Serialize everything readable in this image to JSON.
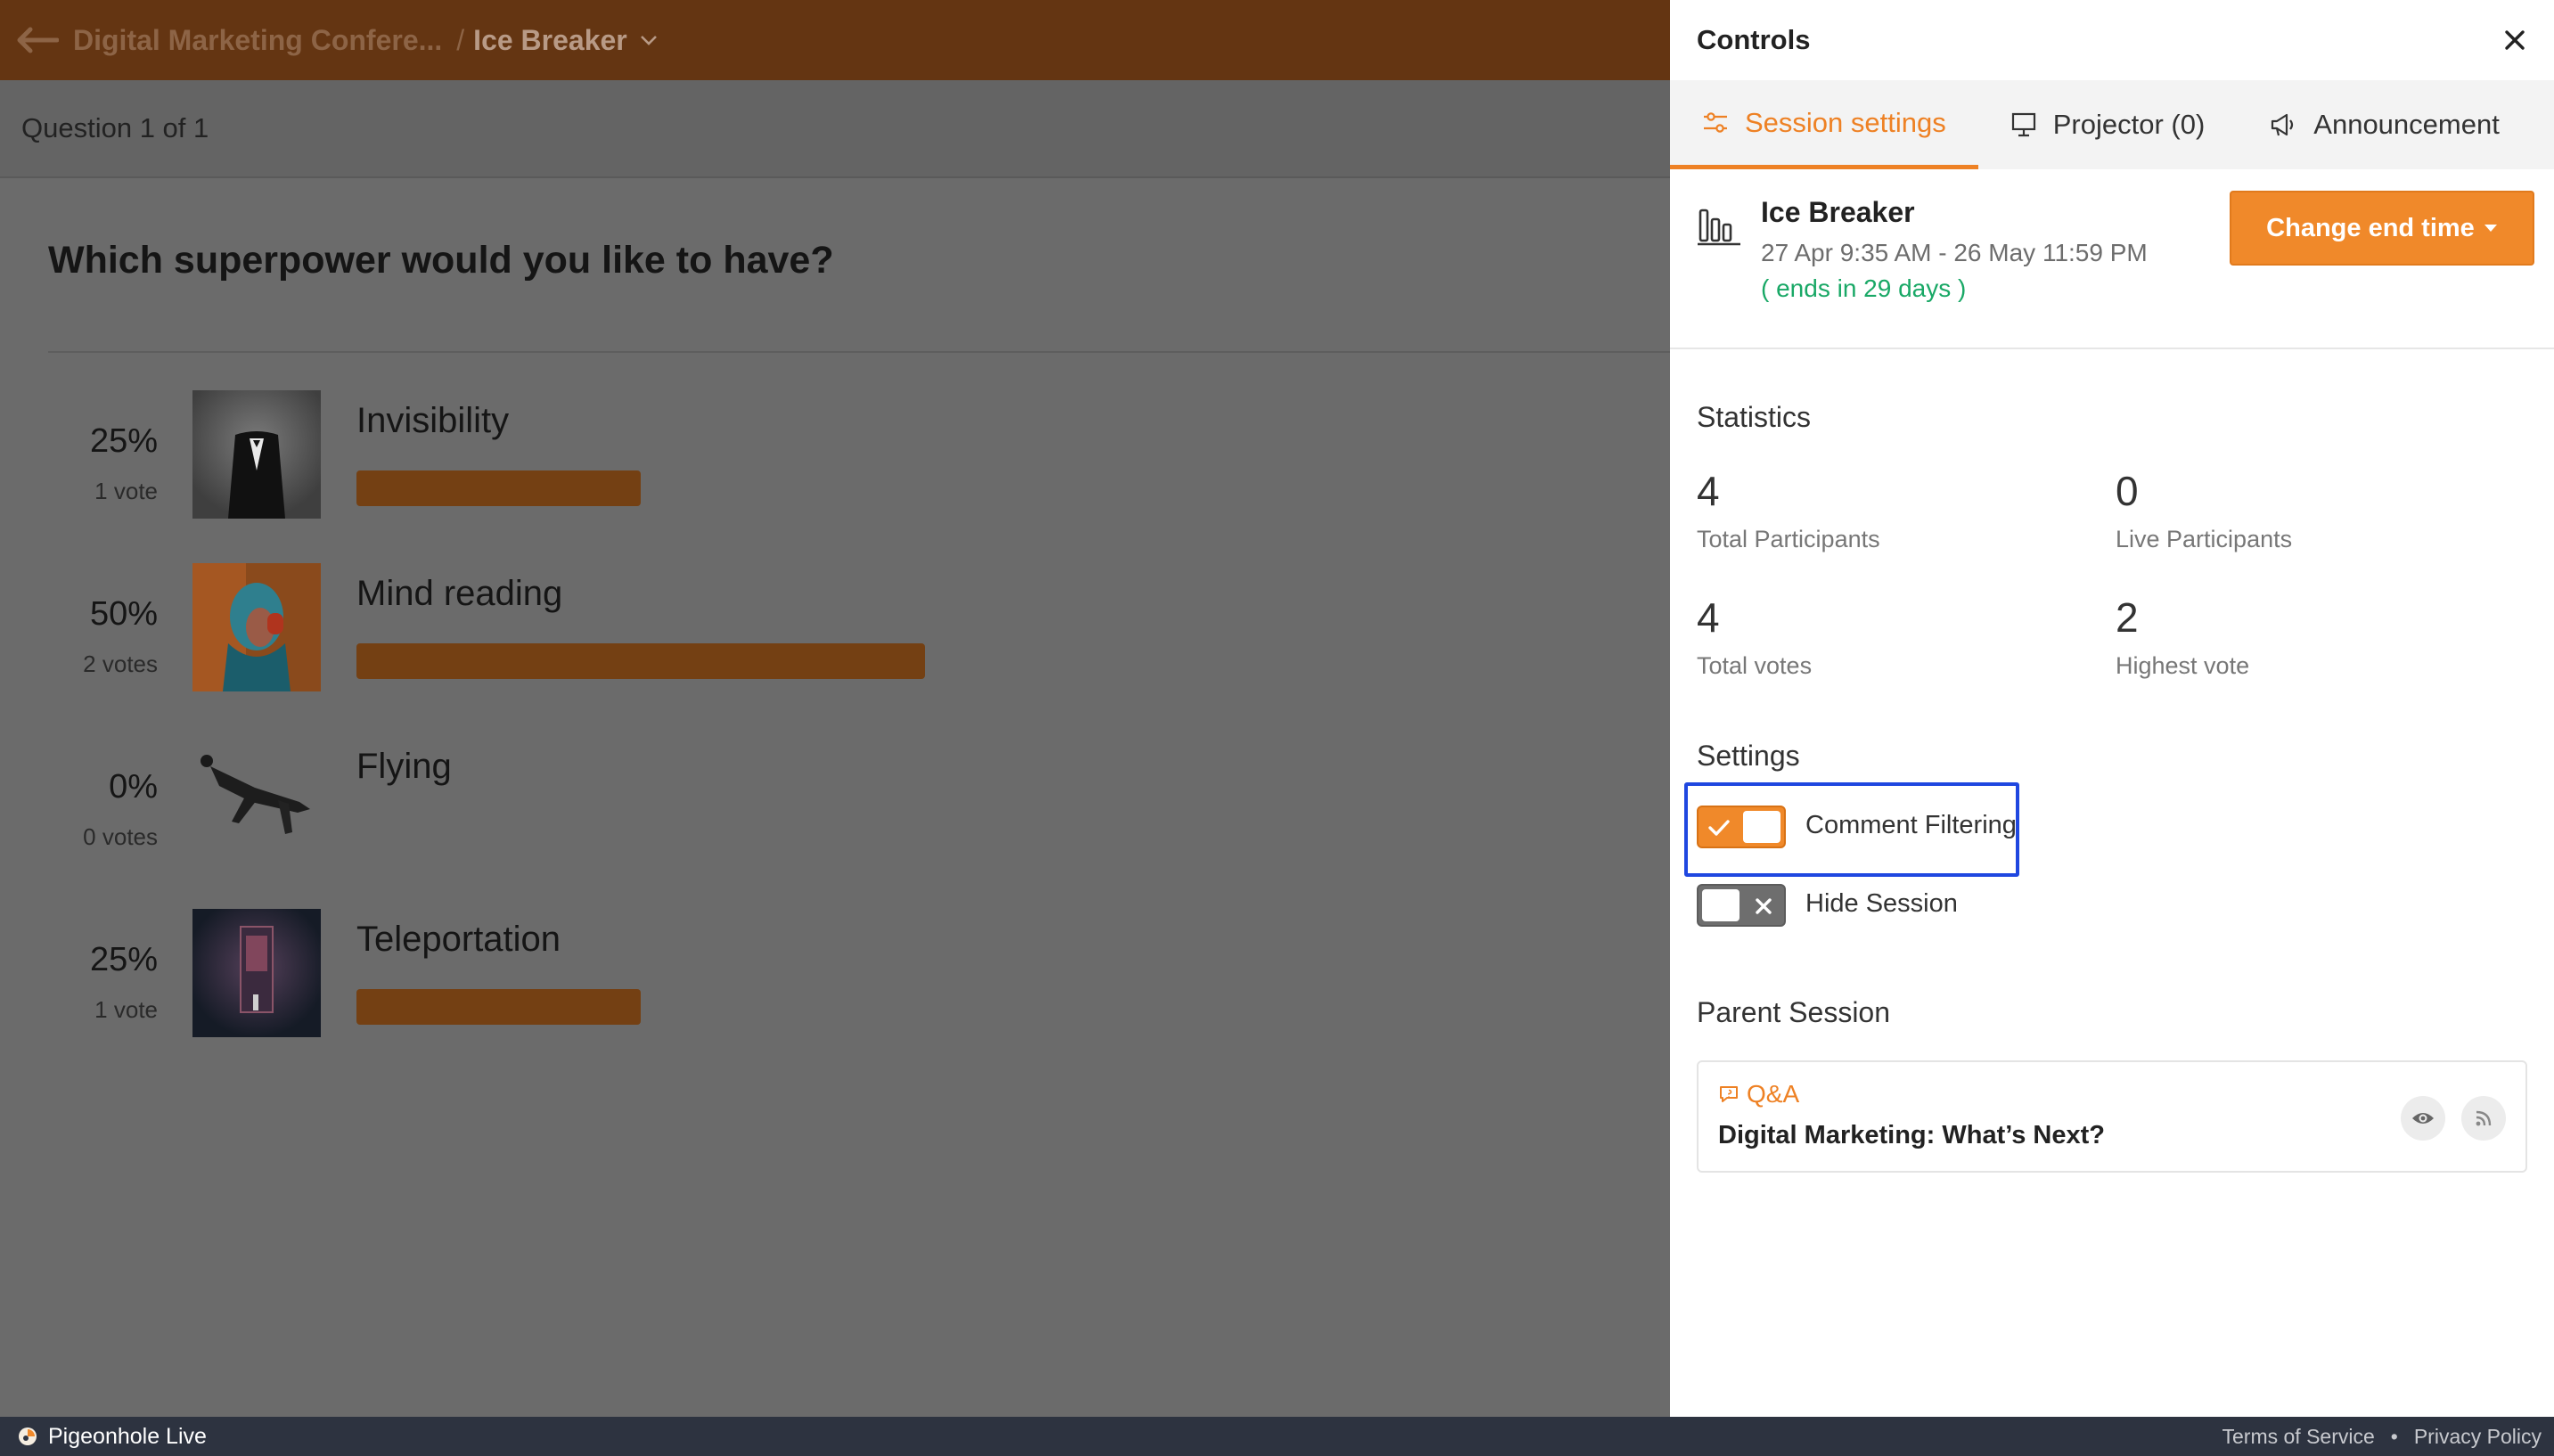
{
  "header": {
    "breadcrumb_event": "Digital Marketing Confere...",
    "breadcrumb_separator": "/",
    "breadcrumb_session": "Ice Breaker"
  },
  "subbar": {
    "question_count": "Question 1 of 1"
  },
  "question": {
    "title": "Which superpower would you like to have?",
    "options": [
      {
        "label": "Invisibility",
        "percent": "25%",
        "votes": "1 vote",
        "share": 0.25
      },
      {
        "label": "Mind reading",
        "percent": "50%",
        "votes": "2 votes",
        "share": 0.5
      },
      {
        "label": "Flying",
        "percent": "0%",
        "votes": "0 votes",
        "share": 0
      },
      {
        "label": "Teleportation",
        "percent": "25%",
        "votes": "1 vote",
        "share": 0.25
      }
    ]
  },
  "panel": {
    "title": "Controls",
    "tabs": [
      {
        "label": "Session settings",
        "active": true
      },
      {
        "label": "Projector (0)",
        "active": false
      },
      {
        "label": "Announcement",
        "active": false
      }
    ],
    "session": {
      "name": "Ice Breaker",
      "dates": "27 Apr 9:35 AM - 26 May 11:59 PM",
      "ends": "( ends in 29 days )",
      "change_button": "Change end time"
    },
    "statistics": {
      "title": "Statistics",
      "items": [
        {
          "value": "4",
          "label": "Total Participants"
        },
        {
          "value": "0",
          "label": "Live Participants"
        },
        {
          "value": "4",
          "label": "Total votes"
        },
        {
          "value": "2",
          "label": "Highest vote"
        }
      ]
    },
    "settings": {
      "title": "Settings",
      "comment_filtering": {
        "label": "Comment Filtering",
        "on": true
      },
      "hide_session": {
        "label": "Hide Session",
        "on": false
      }
    },
    "parent": {
      "title": "Parent Session",
      "type": "Q&A",
      "name": "Digital Marketing: What’s Next?"
    }
  },
  "footer": {
    "brand": "Pigeonhole Live",
    "terms": "Terms of Service",
    "dot": "•",
    "privacy": "Privacy Policy"
  },
  "colors": {
    "accent": "#ee8124",
    "highlight": "#1f47e0",
    "ends_green": "#19a866"
  }
}
